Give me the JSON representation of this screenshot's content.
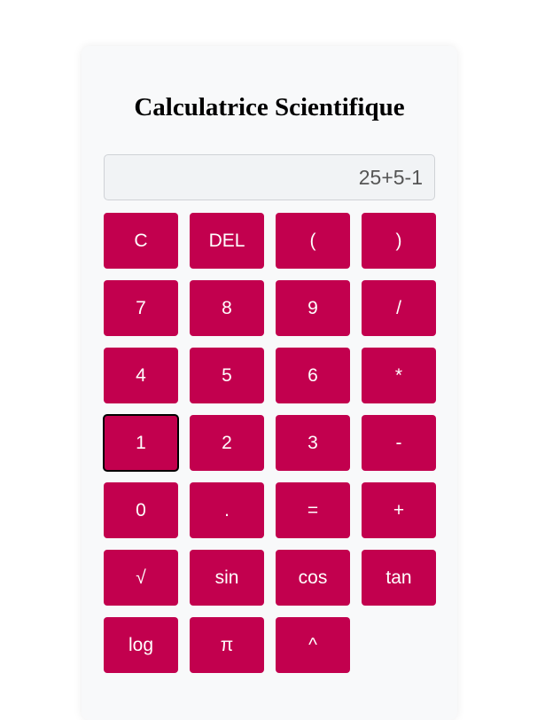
{
  "title": "Calculatrice Scientifique",
  "display": {
    "value": "25+5-1"
  },
  "accent_color": "#c2004e",
  "keys": [
    "C",
    "DEL",
    "(",
    ")",
    "7",
    "8",
    "9",
    "/",
    "4",
    "5",
    "6",
    "*",
    "1",
    "2",
    "3",
    "-",
    "0",
    ".",
    "=",
    "+",
    "√",
    "sin",
    "cos",
    "tan",
    "log",
    "π",
    "^"
  ],
  "focused_key": "1"
}
